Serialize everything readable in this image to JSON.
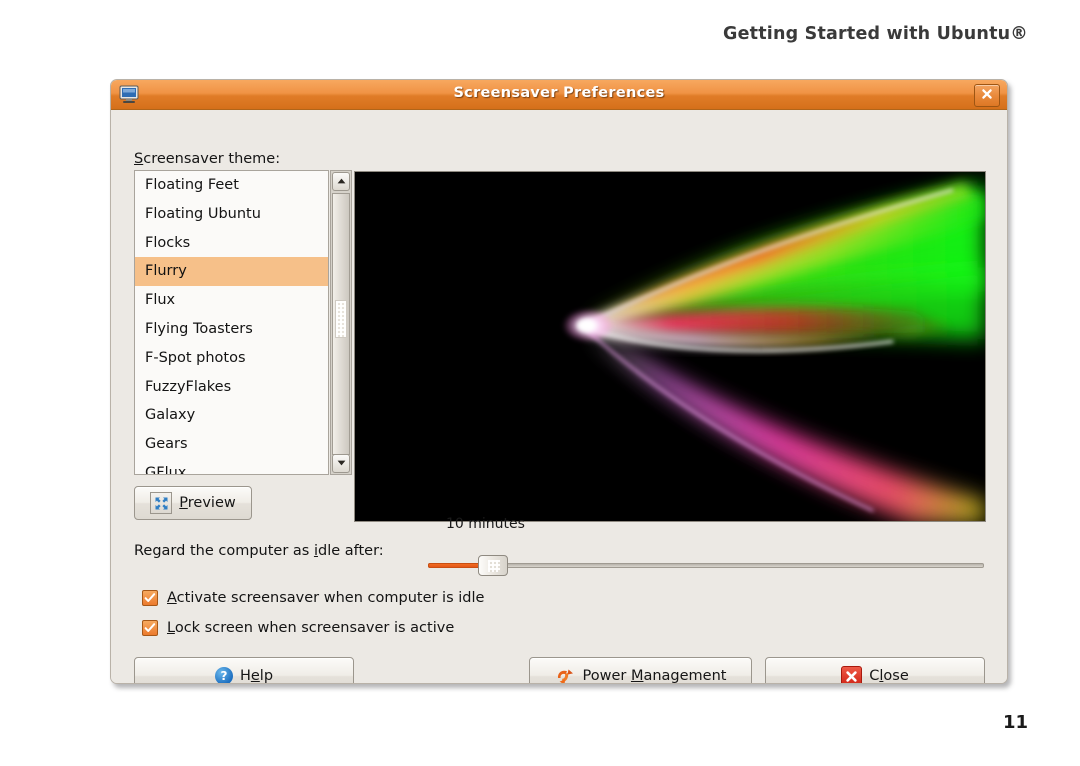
{
  "page": {
    "header_title": "Getting Started with Ubuntu®",
    "page_number": "11"
  },
  "window": {
    "title": "Screensaver Preferences",
    "icon": "display-monitor-icon",
    "close_icon": "window-close-icon"
  },
  "theme_section": {
    "label_prefix": "S",
    "label_rest": "creensaver theme:",
    "items": [
      "Floating Feet",
      "Floating Ubuntu",
      "Flocks",
      "Flurry",
      "Flux",
      "Flying Toasters",
      "F-Spot photos",
      "FuzzyFlakes",
      "Galaxy",
      "Gears",
      "GFlux"
    ],
    "selected": "Flurry",
    "scrollbar": {
      "up_icon": "triangle-up-icon",
      "down_icon": "triangle-down-icon",
      "thumb": "scrollbar-thumb"
    }
  },
  "preview": {
    "button_prefix": "P",
    "button_rest": "review",
    "button_icon": "fullscreen-arrows-icon",
    "screen_alt": "flurry-screensaver-preview"
  },
  "idle": {
    "label_a": "Regard the computer as ",
    "label_mnemonic": "i",
    "label_b": "dle after:",
    "slider_value": "10 minutes",
    "slider_fill_percent": 10
  },
  "options": [
    {
      "mnemonic": "A",
      "label_rest": "ctivate screensaver when computer is idle",
      "checked": true,
      "name": "activate-screensaver-checkbox"
    },
    {
      "mnemonic": "L",
      "label_rest": "ock screen when screensaver is active",
      "checked": true,
      "name": "lock-screen-checkbox"
    }
  ],
  "buttons": {
    "help": {
      "prefix": "H",
      "mnemonic": "e",
      "rest": "lp",
      "icon": "help-question-icon"
    },
    "power": {
      "prefix": "Power ",
      "mnemonic": "M",
      "rest": "anagement",
      "icon": "power-arrow-icon"
    },
    "close": {
      "prefix": "C",
      "mnemonic": "l",
      "rest": "ose",
      "icon": "close-x-icon"
    }
  },
  "colors": {
    "titlebar_orange": "#ee8f3f",
    "selection_orange": "#f6c089",
    "checkbox_orange": "#ec7a2c",
    "slider_fill": "#f16c20",
    "dialog_bg": "#ece9e4",
    "page_bg": "#ffffff"
  }
}
